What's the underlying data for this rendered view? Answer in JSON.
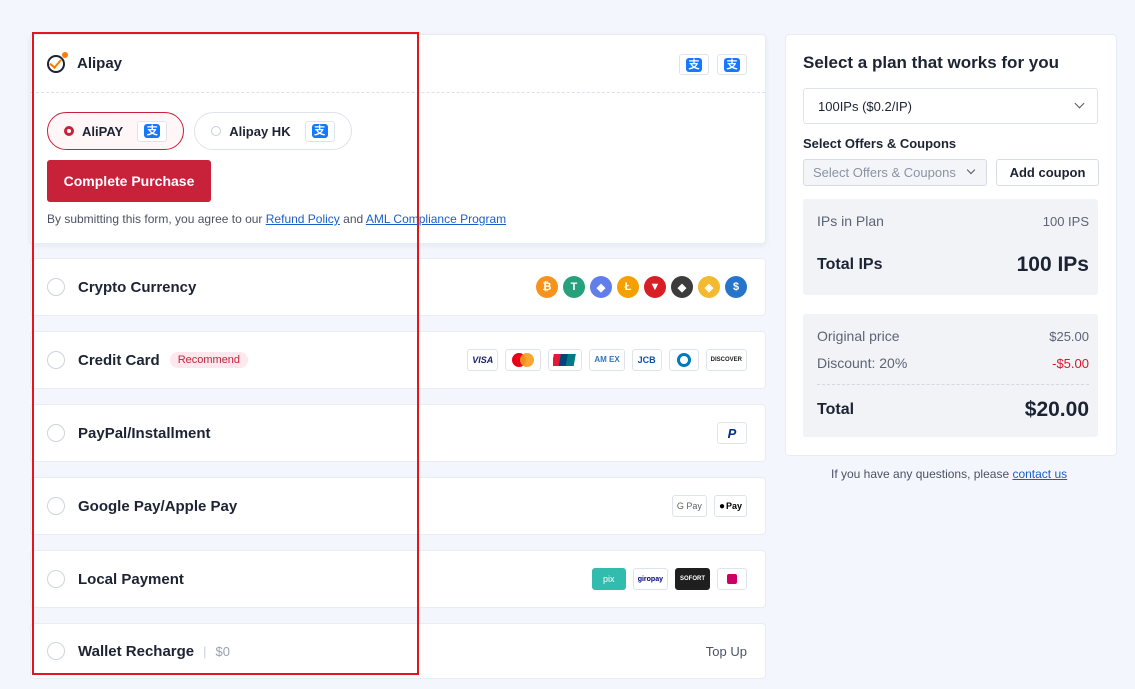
{
  "alipay": {
    "title": "Alipay",
    "options": [
      {
        "label": "AliPAY",
        "selected": true
      },
      {
        "label": "Alipay HK",
        "selected": false
      }
    ],
    "complete_label": "Complete Purchase",
    "terms_prefix": "By submitting this form, you agree to our ",
    "refund_link": "Refund Policy",
    "terms_and": " and ",
    "aml_link": "AML Compliance Program"
  },
  "payment_methods": [
    {
      "label": "Crypto Currency",
      "icons": [
        "bitcoin-icon",
        "tether-icon",
        "ethereum-icon",
        "litecoin-icon",
        "tron-icon",
        "ethereum-classic-icon",
        "binance-icon",
        "usdc-icon"
      ]
    },
    {
      "label": "Credit Card",
      "badge": "Recommend",
      "icons": [
        "visa-icon",
        "mastercard-icon",
        "unionpay-icon",
        "amex-icon",
        "jcb-icon",
        "diners-icon",
        "discover-icon"
      ]
    },
    {
      "label": "PayPal/Installment",
      "icons": [
        "paypal-icon"
      ]
    },
    {
      "label": "Google Pay/Apple Pay",
      "icons": [
        "google-pay-icon",
        "apple-pay-icon"
      ]
    },
    {
      "label": "Local Payment",
      "icons": [
        "pix-icon",
        "giropay-icon",
        "sofort-icon",
        "ideal-icon"
      ]
    },
    {
      "label": "Wallet Recharge",
      "balance": "$0",
      "action": "Top Up"
    }
  ],
  "brand_text": {
    "visa": "VISA",
    "amex": "AM EX",
    "jcb": "JCB",
    "discover": "DISCOVER",
    "gpay": "G Pay",
    "apay": "Pay",
    "pix": "pix",
    "giropay": "giropay",
    "sofort": "SOFORT"
  },
  "plan": {
    "title": "Select a plan that works for you",
    "selected_plan": "100IPs ($0.2/IP)",
    "offers_label": "Select Offers & Coupons",
    "offers_placeholder": "Select Offers & Coupons",
    "add_coupon": "Add coupon",
    "ips_in_plan_label": "IPs in Plan",
    "ips_in_plan_value": "100 IPS",
    "total_ips_label": "Total IPs",
    "total_ips_value": "100 IPs",
    "original_price_label": "Original price",
    "original_price_value": "$25.00",
    "discount_label": "Discount: 20%",
    "discount_value": "-$5.00",
    "total_label": "Total",
    "total_value": "$20.00"
  },
  "contact": {
    "prefix": "If you have any questions, please ",
    "link": "contact us"
  },
  "colors": {
    "accent": "#c8213a",
    "link": "#1a5fc7",
    "highlight_box": "#e5161b"
  }
}
